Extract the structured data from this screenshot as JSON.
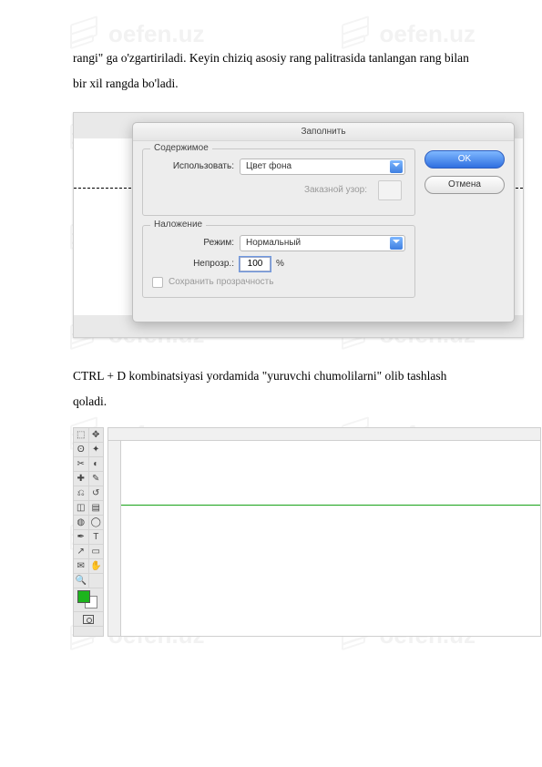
{
  "watermark_text": "oefen.uz",
  "paragraph1": "rangi\" ga o'zgartiriladi. Keyin chiziq asosiy rang palitrasida tanlangan rang bilan bir xil rangda bo'ladi.",
  "paragraph2": "CTRL + D kombinatsiyasi yordamida \"yuruvchi chumolilarni\" olib tashlash qoladi.",
  "dialog": {
    "title": "Заполнить",
    "group_content": "Содержимое",
    "use_label": "Использовать:",
    "use_value": "Цвет фона",
    "pattern_label": "Заказной узор:",
    "group_overlay": "Наложение",
    "mode_label": "Режим:",
    "mode_value": "Нормальный",
    "opacity_label": "Непрозр.:",
    "opacity_value": "100",
    "opacity_pct": "%",
    "preserve_label": "Сохранить прозрачность",
    "ok": "OK",
    "cancel": "Отмена"
  },
  "tools": {
    "selection": "⬚",
    "move": "✥",
    "lasso": "ʘ",
    "wand": "✦",
    "crop": "✂",
    "eyedropper": "◐",
    "healing": "✚",
    "brush": "✎",
    "stamp": "⎌",
    "history": "↺",
    "eraser": "◫",
    "gradient": "▤",
    "blur": "◍",
    "dodge": "◯",
    "pen": "✒",
    "type": "T",
    "path": "↗",
    "shape": "▭",
    "notes": "✉",
    "hand": "✋",
    "zoom": "🔍"
  }
}
